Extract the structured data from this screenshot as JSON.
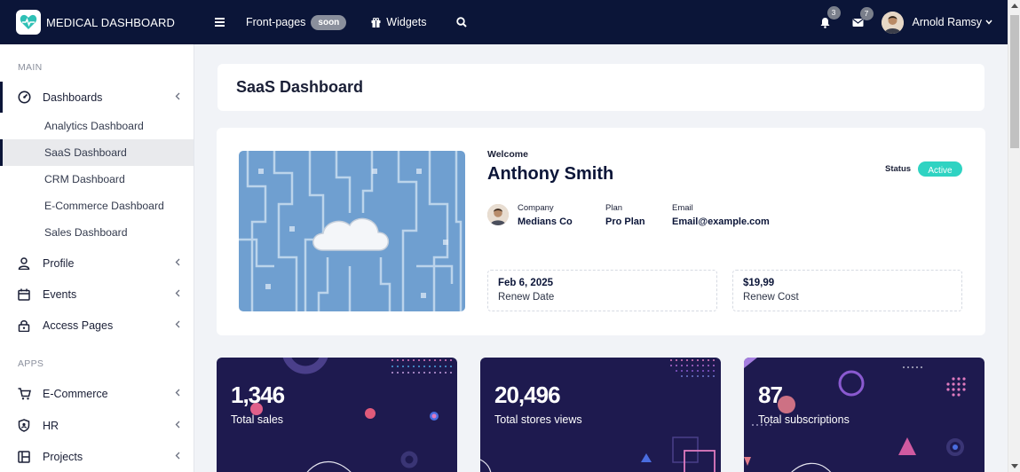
{
  "topbar": {
    "brand": "MEDICAL DASHBOARD",
    "frontpages_label": "Front-pages",
    "soon_badge": "soon",
    "widgets_label": "Widgets",
    "notifications_count": "3",
    "messages_count": "7",
    "user_name": "Arnold Ramsy"
  },
  "sidebar": {
    "main_label": "MAIN",
    "apps_label": "APPS",
    "items": [
      {
        "label": "Dashboards"
      },
      {
        "label": "Profile"
      },
      {
        "label": "Events"
      },
      {
        "label": "Access Pages"
      },
      {
        "label": "E-Commerce"
      },
      {
        "label": "HR"
      },
      {
        "label": "Projects"
      }
    ],
    "dashboards_sub": [
      {
        "label": "Analytics Dashboard"
      },
      {
        "label": "SaaS Dashboard"
      },
      {
        "label": "CRM Dashboard"
      },
      {
        "label": "E-Commerce Dashboard"
      },
      {
        "label": "Sales Dashboard"
      }
    ]
  },
  "page": {
    "title": "SaaS Dashboard"
  },
  "profile": {
    "welcome": "Welcome",
    "name": "Anthony Smith",
    "status_label": "Status",
    "status_value": "Active",
    "company_label": "Company",
    "company_value": "Medians Co",
    "plan_label": "Plan",
    "plan_value": "Pro Plan",
    "email_label": "Email",
    "email_value": "Email@example.com",
    "renew_date_value": "Feb 6, 2025",
    "renew_date_label": "Renew Date",
    "renew_cost_value": "$19,99",
    "renew_cost_label": "Renew Cost"
  },
  "stats": [
    {
      "value": "1,346",
      "label": "Total sales"
    },
    {
      "value": "20,496",
      "label": "Total stores views"
    },
    {
      "value": "87",
      "label": "Total subscriptions"
    }
  ],
  "colors": {
    "topbar": "#0b1538",
    "accent_active": "#2fd3c2",
    "stat_card": "#1e1a4f"
  }
}
